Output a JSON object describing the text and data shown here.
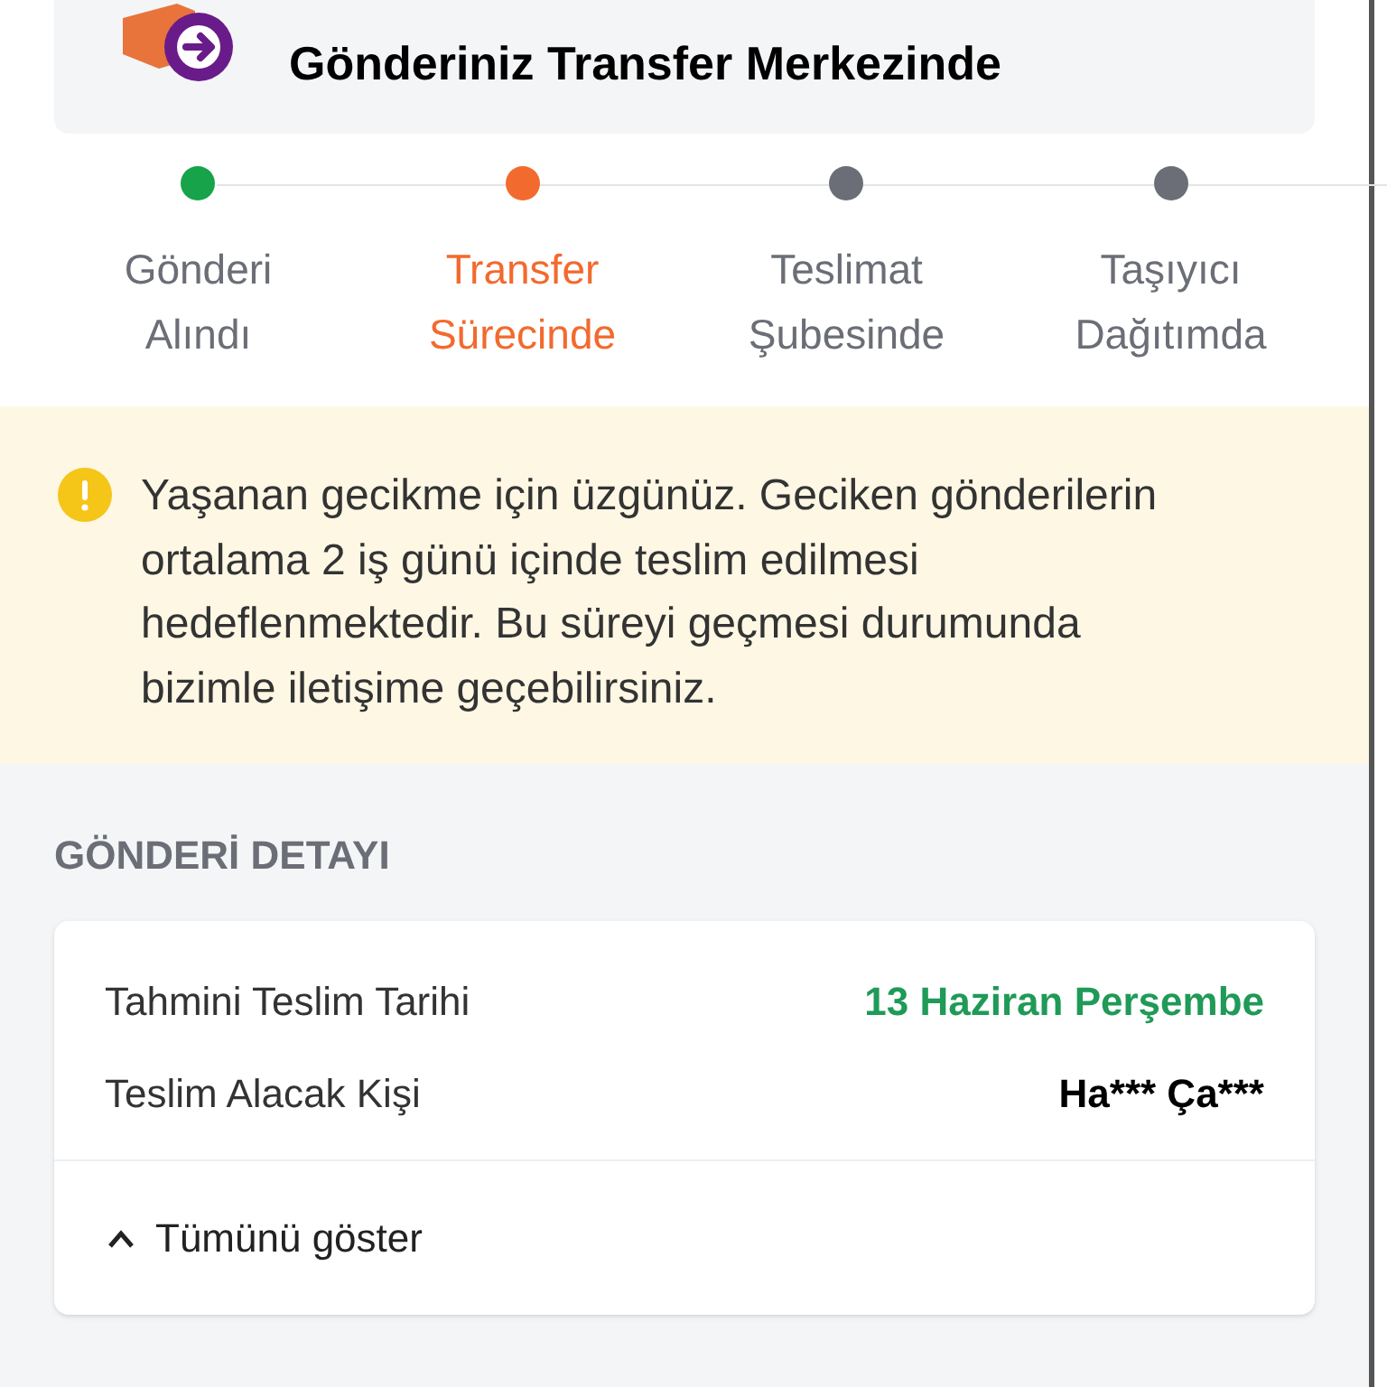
{
  "status_card": {
    "title": "Gönderiniz Transfer Merkezinde"
  },
  "steps": [
    {
      "label": "Gönderi Alındı",
      "kind": "done"
    },
    {
      "label": "Transfer Sürecinde",
      "kind": "current"
    },
    {
      "label": "Teslimat Şubesinde",
      "kind": "pending"
    },
    {
      "label": "Taşıyıcı Dağıtımda",
      "kind": "pending"
    }
  ],
  "notice": {
    "text": "Yaşanan gecikme için üzgünüz. Geciken gönderilerin ortalama 2 iş günü içinde teslim edilmesi hedeflenmektedir. Bu süreyi geçmesi durumunda bizimle iletişime geçebilirsiniz."
  },
  "details": {
    "heading": "GÖNDERİ DETAYI",
    "rows": [
      {
        "label": "Tahmini Teslim Tarihi",
        "value": "13 Haziran Perşembe",
        "kind": "highlight"
      },
      {
        "label": "Teslim Alacak Kişi",
        "value": "Ha*** Ça***",
        "kind": "plain"
      }
    ],
    "toggle": {
      "label": "Tümünü göster",
      "expanded": false
    }
  }
}
